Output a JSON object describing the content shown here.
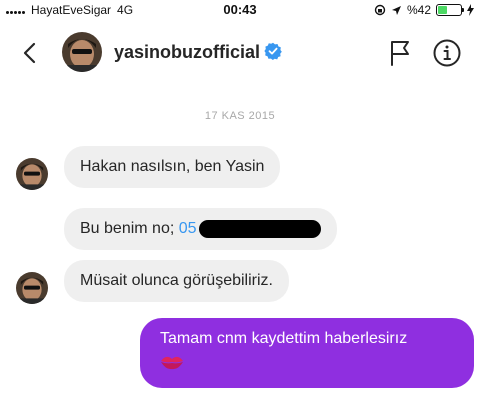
{
  "status_bar": {
    "carrier": "HayatEveSigar",
    "network": "4G",
    "time": "00:43",
    "battery": "%42",
    "battery_level": 0.42,
    "battery_color": "#4cd964"
  },
  "header": {
    "username": "yasinobuzofficial",
    "verified": true,
    "verified_color": "#3897f0",
    "icons": [
      "back-icon",
      "flag-icon",
      "info-icon"
    ]
  },
  "conversation": {
    "date": "17 KAS 2015",
    "messages": [
      {
        "sender": "incoming",
        "text": "Hakan nasılsın, ben Yasin"
      },
      {
        "sender": "incoming",
        "text_prefix": "Bu benim no; ",
        "phone_visible": "05",
        "redacted": true
      },
      {
        "sender": "incoming",
        "text": "Müsait olunca görüşebiliriz."
      },
      {
        "sender": "outgoing",
        "text": "Tamam cnm kaydettim haberlesirız",
        "emoji": "kiss-mark-icon"
      }
    ],
    "colors": {
      "incoming_bubble": "#efefef",
      "outgoing_bubble": "#8f2fe0"
    }
  }
}
